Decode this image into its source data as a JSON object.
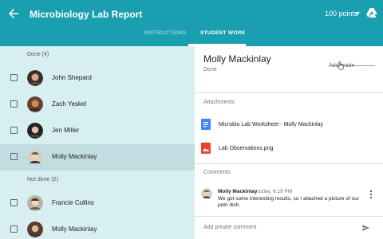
{
  "header": {
    "title": "Microbiology Lab Report",
    "points": "100 points",
    "tabs": [
      "INSTRUCTIONS",
      "STUDENT WORK"
    ]
  },
  "students": {
    "done_label": "Done (4)",
    "done": [
      {
        "name": "John Shepard"
      },
      {
        "name": "Zach Yeskel"
      },
      {
        "name": "Jen Miller"
      },
      {
        "name": "Molly Mackinlay"
      }
    ],
    "not_done_label": "Not done (2)",
    "not_done": [
      {
        "name": "Francie Collins"
      },
      {
        "name": "Molly Mackinlay"
      }
    ]
  },
  "detail": {
    "name": "Molly Mackinlay",
    "status": "Done",
    "grade_placeholder": "Add grade",
    "attachments_label": "Attachments",
    "attachments": [
      {
        "name": "Microbio Lab Worksheet - Molly Mackinlay",
        "icon": "docs-icon",
        "color": "#4285f4"
      },
      {
        "name": "Lab Observations.png",
        "icon": "image-icon",
        "color": "#ea4335"
      }
    ],
    "comments_label": "Comments",
    "comment": {
      "author": "Molly Mackinlay",
      "time": "today, 6:19 PM",
      "text": "We got some interesting results, so I attached a picture of our petri dish."
    },
    "private_comment_placeholder": "Add private comment"
  },
  "colors": {
    "app_bar": "#1a9fb0",
    "list_background": "#d8eff2",
    "selected_row": "#c2dde2"
  }
}
